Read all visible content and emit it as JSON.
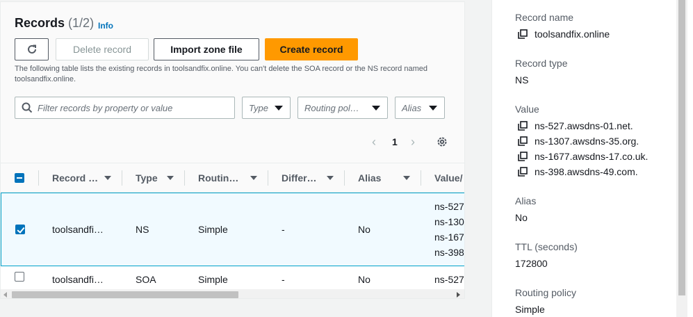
{
  "records": {
    "title": "Records",
    "count": "(1/2)",
    "info": "Info",
    "buttons": {
      "delete": "Delete record",
      "import": "Import zone file",
      "create": "Create record"
    },
    "description": "The following table lists the existing records in toolsandfix.online. You can't delete the SOA record or the NS record named toolsandfix.online.",
    "filter": {
      "placeholder": "Filter records by property or value",
      "type": "Type",
      "routing": "Routing pol…",
      "alias": "Alias"
    },
    "pagination": {
      "page": "1"
    },
    "columns": [
      "Record …",
      "Type",
      "Routin…",
      "Differ…",
      "Alias",
      "Value/"
    ],
    "rows": [
      {
        "selected": true,
        "name": "toolsandfi…",
        "type": "NS",
        "routing": "Simple",
        "differ": "-",
        "alias": "No",
        "values": [
          "ns-527",
          "ns-130",
          "ns-167",
          "ns-398"
        ]
      },
      {
        "selected": false,
        "name": "toolsandfi…",
        "type": "SOA",
        "routing": "Simple",
        "differ": "-",
        "alias": "No",
        "values": [
          "ns-527"
        ]
      }
    ]
  },
  "details": {
    "record_name_label": "Record name",
    "record_name": "toolsandfix.online",
    "record_type_label": "Record type",
    "record_type": "NS",
    "value_label": "Value",
    "values": [
      "ns-527.awsdns-01.net.",
      "ns-1307.awsdns-35.org.",
      "ns-1677.awsdns-17.co.uk.",
      "ns-398.awsdns-49.com."
    ],
    "alias_label": "Alias",
    "alias": "No",
    "ttl_label": "TTL (seconds)",
    "ttl": "172800",
    "routing_label": "Routing policy",
    "routing": "Simple"
  },
  "icons": [
    "refresh-icon",
    "search-icon",
    "gear-icon",
    "copy-icon",
    "chevron-left-icon",
    "chevron-right-icon",
    "caret-down-icon"
  ],
  "colors": {
    "primary": "#ff9900",
    "link": "#0073bb",
    "selected_row_bg": "#f1faff",
    "selected_row_border": "#00a1c9"
  }
}
